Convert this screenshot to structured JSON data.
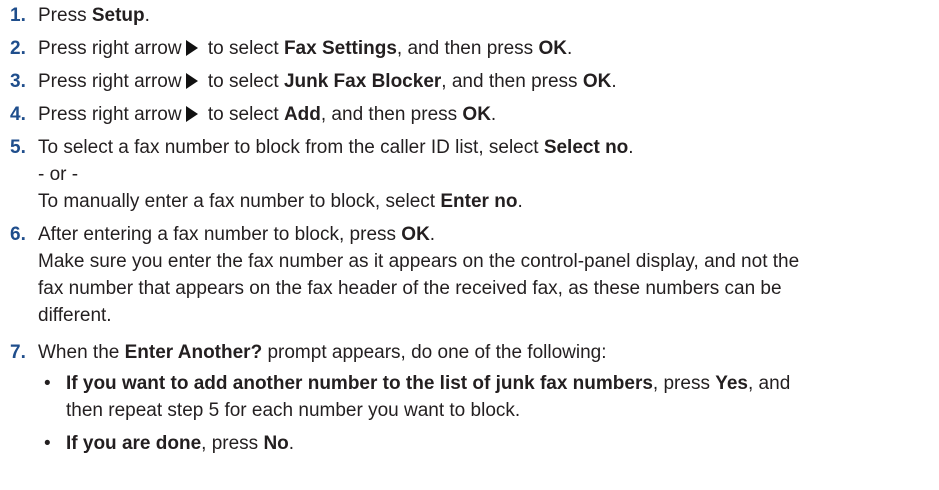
{
  "steps": [
    {
      "number": "1.",
      "pre": "Press ",
      "bold1": "Setup",
      "post": "."
    },
    {
      "number": "2.",
      "pre": "Press right arrow",
      "mid": " to select ",
      "bold1": "Fax Settings",
      "and": ", and then press ",
      "bold2": "OK",
      "post": "."
    },
    {
      "number": "3.",
      "pre": "Press right arrow",
      "mid": " to select ",
      "bold1": "Junk Fax Blocker",
      "and": ", and then press ",
      "bold2": "OK",
      "post": "."
    },
    {
      "number": "4.",
      "pre": "Press right arrow",
      "mid": " to select ",
      "bold1": "Add",
      "and": ", and then press ",
      "bold2": "OK",
      "post": "."
    },
    {
      "number": "5.",
      "line1_pre": "To select a fax number to block from the caller ID list, select ",
      "line1_bold": "Select no",
      "line1_post": ".",
      "or": "- or -",
      "line2_pre": "To manually enter a fax number to block, select ",
      "line2_bold": "Enter no",
      "line2_post": "."
    },
    {
      "number": "6.",
      "line1_pre": "After entering a fax number to block, press ",
      "line1_bold": "OK",
      "line1_post": ".",
      "note": "Make sure you enter the fax number as it appears on the control-panel display, and not the fax number that appears on the fax header of the received fax, as these numbers can be different."
    },
    {
      "number": "7.",
      "line1_pre": "When the ",
      "line1_bold": "Enter Another?",
      "line1_post": " prompt appears, do one of the following:",
      "bullets": [
        {
          "bold": "If you want to add another number to the list of junk fax numbers",
          "text1": ", press ",
          "bold2": "Yes",
          "text2": ", and then repeat step 5 for each number you want to block."
        },
        {
          "bold": "If you are done",
          "text1": ", press ",
          "bold2": "No",
          "text2": "."
        }
      ]
    }
  ],
  "icons": {
    "arrow": "right-arrow-icon"
  },
  "colors": {
    "step_number": "#1f4e8c",
    "text": "#231f20"
  },
  "bullet_char": "•"
}
